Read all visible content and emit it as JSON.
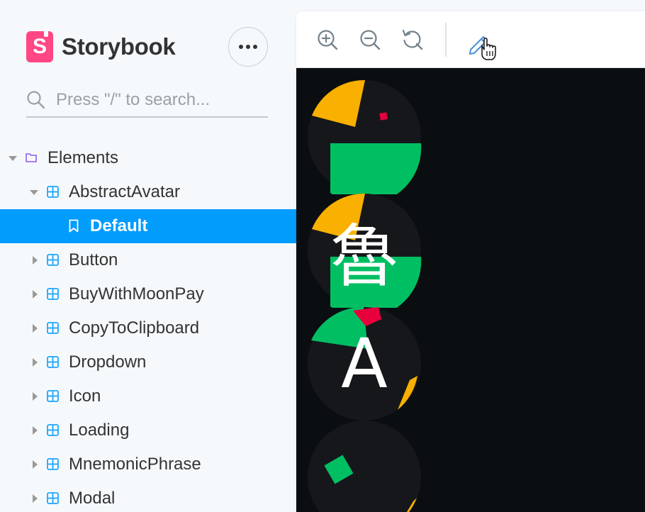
{
  "sidebar": {
    "brand": {
      "logo_letter": "S",
      "name": "Storybook"
    },
    "search": {
      "placeholder": "Press \"/\" to search..."
    },
    "tree": [
      {
        "label": "Elements",
        "kind": "folder",
        "expanded": true
      },
      {
        "label": "AbstractAvatar",
        "kind": "component",
        "expanded": true
      },
      {
        "label": "Default",
        "kind": "story",
        "selected": true
      },
      {
        "label": "Button",
        "kind": "component",
        "expanded": false
      },
      {
        "label": "BuyWithMoonPay",
        "kind": "component",
        "expanded": false
      },
      {
        "label": "CopyToClipboard",
        "kind": "component",
        "expanded": false
      },
      {
        "label": "Dropdown",
        "kind": "component",
        "expanded": false
      },
      {
        "label": "Icon",
        "kind": "component",
        "expanded": false
      },
      {
        "label": "Loading",
        "kind": "component",
        "expanded": false
      },
      {
        "label": "MnemonicPhrase",
        "kind": "component",
        "expanded": false
      },
      {
        "label": "Modal",
        "kind": "component",
        "expanded": false
      }
    ]
  },
  "toolbar": {
    "icons": [
      "zoom-in-icon",
      "zoom-out-icon",
      "reset-zoom-icon",
      "pencil-icon"
    ]
  },
  "canvas": {
    "avatars": [
      {
        "text": ""
      },
      {
        "text": "魯"
      },
      {
        "text": "A"
      },
      {
        "text": ""
      }
    ]
  },
  "colors": {
    "accent": "#029cfd",
    "brand": "#ff4785",
    "canvas_bg": "#0b0e11",
    "avatar_bg": "#16171b",
    "yellow": "#f9b000",
    "green": "#00bf63",
    "red": "#e8003d"
  }
}
